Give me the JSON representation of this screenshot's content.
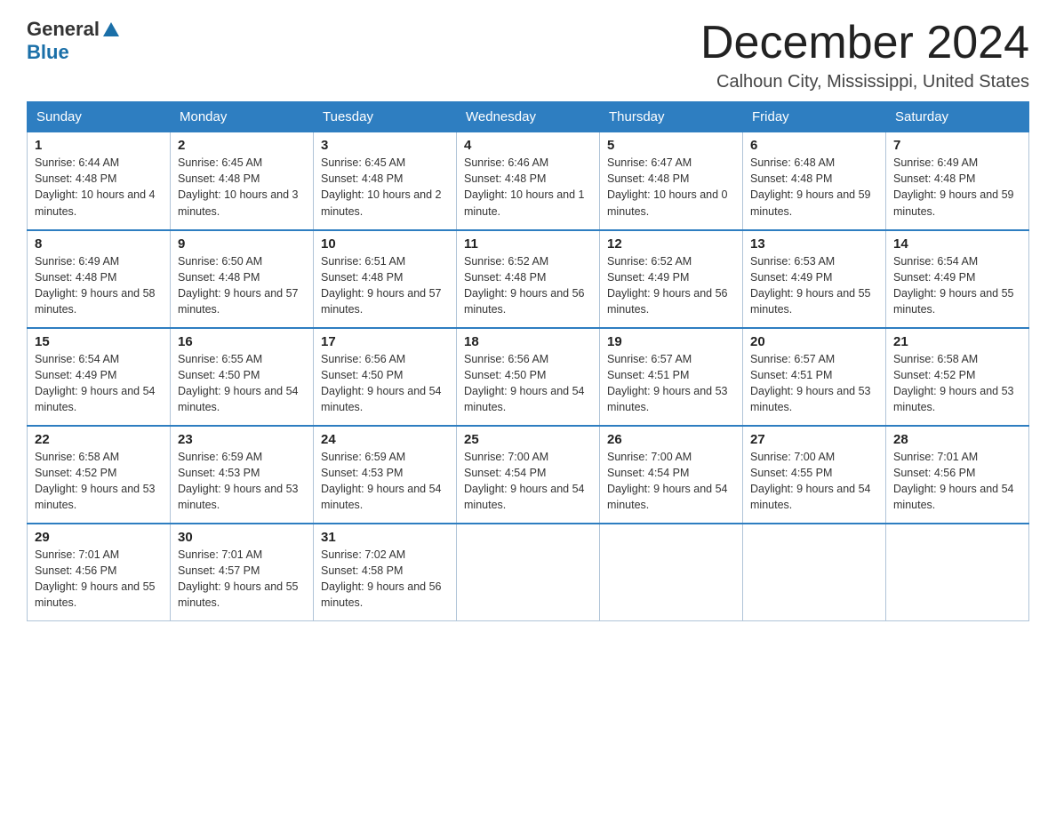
{
  "logo": {
    "general": "General",
    "blue": "Blue"
  },
  "header": {
    "month": "December 2024",
    "location": "Calhoun City, Mississippi, United States"
  },
  "weekdays": [
    "Sunday",
    "Monday",
    "Tuesday",
    "Wednesday",
    "Thursday",
    "Friday",
    "Saturday"
  ],
  "weeks": [
    [
      {
        "day": "1",
        "sunrise": "6:44 AM",
        "sunset": "4:48 PM",
        "daylight": "10 hours and 4 minutes."
      },
      {
        "day": "2",
        "sunrise": "6:45 AM",
        "sunset": "4:48 PM",
        "daylight": "10 hours and 3 minutes."
      },
      {
        "day": "3",
        "sunrise": "6:45 AM",
        "sunset": "4:48 PM",
        "daylight": "10 hours and 2 minutes."
      },
      {
        "day": "4",
        "sunrise": "6:46 AM",
        "sunset": "4:48 PM",
        "daylight": "10 hours and 1 minute."
      },
      {
        "day": "5",
        "sunrise": "6:47 AM",
        "sunset": "4:48 PM",
        "daylight": "10 hours and 0 minutes."
      },
      {
        "day": "6",
        "sunrise": "6:48 AM",
        "sunset": "4:48 PM",
        "daylight": "9 hours and 59 minutes."
      },
      {
        "day": "7",
        "sunrise": "6:49 AM",
        "sunset": "4:48 PM",
        "daylight": "9 hours and 59 minutes."
      }
    ],
    [
      {
        "day": "8",
        "sunrise": "6:49 AM",
        "sunset": "4:48 PM",
        "daylight": "9 hours and 58 minutes."
      },
      {
        "day": "9",
        "sunrise": "6:50 AM",
        "sunset": "4:48 PM",
        "daylight": "9 hours and 57 minutes."
      },
      {
        "day": "10",
        "sunrise": "6:51 AM",
        "sunset": "4:48 PM",
        "daylight": "9 hours and 57 minutes."
      },
      {
        "day": "11",
        "sunrise": "6:52 AM",
        "sunset": "4:48 PM",
        "daylight": "9 hours and 56 minutes."
      },
      {
        "day": "12",
        "sunrise": "6:52 AM",
        "sunset": "4:49 PM",
        "daylight": "9 hours and 56 minutes."
      },
      {
        "day": "13",
        "sunrise": "6:53 AM",
        "sunset": "4:49 PM",
        "daylight": "9 hours and 55 minutes."
      },
      {
        "day": "14",
        "sunrise": "6:54 AM",
        "sunset": "4:49 PM",
        "daylight": "9 hours and 55 minutes."
      }
    ],
    [
      {
        "day": "15",
        "sunrise": "6:54 AM",
        "sunset": "4:49 PM",
        "daylight": "9 hours and 54 minutes."
      },
      {
        "day": "16",
        "sunrise": "6:55 AM",
        "sunset": "4:50 PM",
        "daylight": "9 hours and 54 minutes."
      },
      {
        "day": "17",
        "sunrise": "6:56 AM",
        "sunset": "4:50 PM",
        "daylight": "9 hours and 54 minutes."
      },
      {
        "day": "18",
        "sunrise": "6:56 AM",
        "sunset": "4:50 PM",
        "daylight": "9 hours and 54 minutes."
      },
      {
        "day": "19",
        "sunrise": "6:57 AM",
        "sunset": "4:51 PM",
        "daylight": "9 hours and 53 minutes."
      },
      {
        "day": "20",
        "sunrise": "6:57 AM",
        "sunset": "4:51 PM",
        "daylight": "9 hours and 53 minutes."
      },
      {
        "day": "21",
        "sunrise": "6:58 AM",
        "sunset": "4:52 PM",
        "daylight": "9 hours and 53 minutes."
      }
    ],
    [
      {
        "day": "22",
        "sunrise": "6:58 AM",
        "sunset": "4:52 PM",
        "daylight": "9 hours and 53 minutes."
      },
      {
        "day": "23",
        "sunrise": "6:59 AM",
        "sunset": "4:53 PM",
        "daylight": "9 hours and 53 minutes."
      },
      {
        "day": "24",
        "sunrise": "6:59 AM",
        "sunset": "4:53 PM",
        "daylight": "9 hours and 54 minutes."
      },
      {
        "day": "25",
        "sunrise": "7:00 AM",
        "sunset": "4:54 PM",
        "daylight": "9 hours and 54 minutes."
      },
      {
        "day": "26",
        "sunrise": "7:00 AM",
        "sunset": "4:54 PM",
        "daylight": "9 hours and 54 minutes."
      },
      {
        "day": "27",
        "sunrise": "7:00 AM",
        "sunset": "4:55 PM",
        "daylight": "9 hours and 54 minutes."
      },
      {
        "day": "28",
        "sunrise": "7:01 AM",
        "sunset": "4:56 PM",
        "daylight": "9 hours and 54 minutes."
      }
    ],
    [
      {
        "day": "29",
        "sunrise": "7:01 AM",
        "sunset": "4:56 PM",
        "daylight": "9 hours and 55 minutes."
      },
      {
        "day": "30",
        "sunrise": "7:01 AM",
        "sunset": "4:57 PM",
        "daylight": "9 hours and 55 minutes."
      },
      {
        "day": "31",
        "sunrise": "7:02 AM",
        "sunset": "4:58 PM",
        "daylight": "9 hours and 56 minutes."
      },
      null,
      null,
      null,
      null
    ]
  ]
}
